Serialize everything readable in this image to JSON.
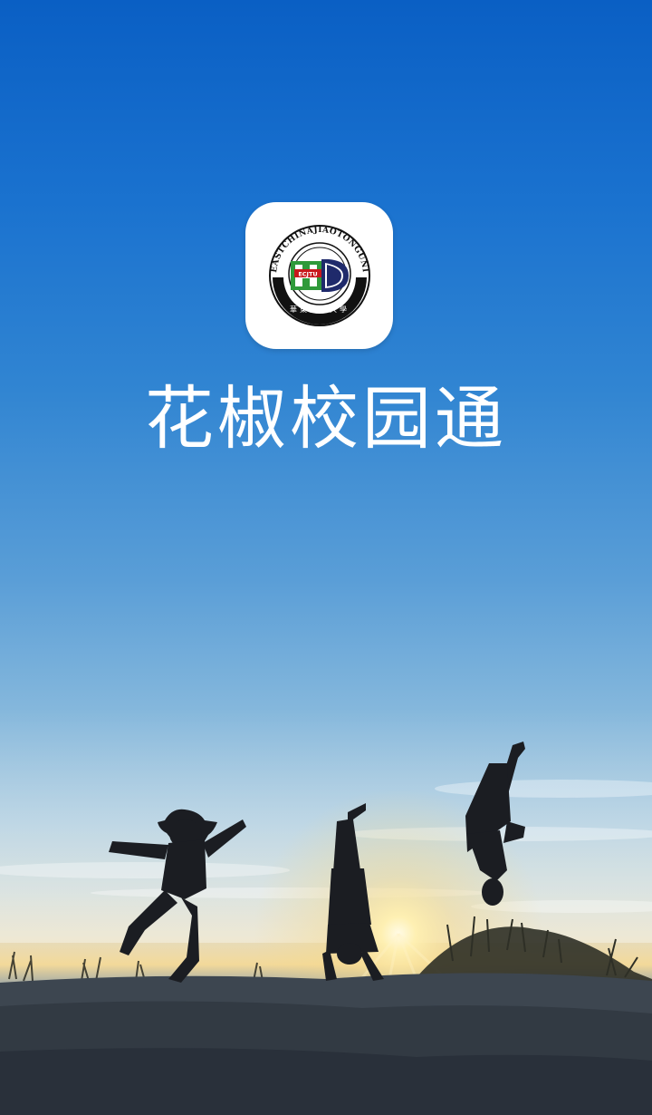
{
  "app": {
    "title": "花椒校园通",
    "logo": {
      "ring_text": "EASTCHINAJIAOTONGUNIVERSITY",
      "center_badge": "ECJTU",
      "seal_script": "華東交通大學"
    }
  },
  "colors": {
    "sky_top": "#0a5fc4",
    "horizon_glow": "#f3d99a",
    "ground": "#2a313a",
    "logo_green": "#2f9a3a",
    "logo_navy": "#1f2a6b",
    "title_text": "#ffffff"
  },
  "icons": {
    "app_icon": "university-logo-icon"
  }
}
